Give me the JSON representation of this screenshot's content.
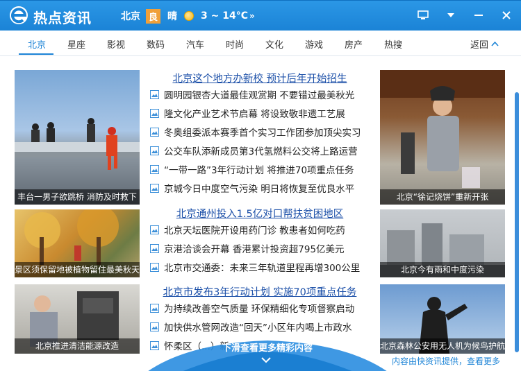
{
  "app": {
    "title": "热点资讯"
  },
  "weather": {
    "city": "北京",
    "air_quality": "良",
    "condition": "晴",
    "temperature": "3 ~ 14°C",
    "more": "»"
  },
  "nav": {
    "tabs": [
      "北京",
      "星座",
      "影视",
      "数码",
      "汽车",
      "时尚",
      "文化",
      "游戏",
      "房产",
      "热搜"
    ],
    "active_index": 0,
    "back_label": "返回"
  },
  "photos": [
    {
      "caption": "丰台一男子欲跳桥  消防及时救下"
    },
    {
      "caption": "北京“徐记烧饼”重新开张"
    },
    {
      "caption": "景区须保留地被植物留住最美秋天"
    },
    {
      "caption": "北京今有雨和中度污染"
    },
    {
      "caption": "北京推进清洁能源改造"
    },
    {
      "caption": "北京森林公安用无人机为候鸟护航"
    }
  ],
  "sections": [
    {
      "headline": "北京这个地方办新校  预计后年开始招生",
      "items": [
        "圆明园银杏大道最佳观赏期  不要错过最美秋光",
        "隆文化产业艺术节启幕  将设致敬非遗工艺展",
        "冬奥组委派本赛季首个实习工作团参加顶尖实习",
        "公交车队添新成员第3代氢燃料公交将上路运营",
        "“一带一路”3年行动计划  将推进70项重点任务",
        "京城今日中度空气污染  明日将恢复至优良水平"
      ]
    },
    {
      "headline": "北京通州投入1.5亿对口帮扶贫困地区",
      "items": [
        "北京天坛医院开设用药门诊  教患者如何吃药",
        "京港洽谈会开幕  香港累计投资超795亿美元",
        "北京市交通委：未来三年轨道里程再增300公里"
      ]
    },
    {
      "headline": "北京市发布3年行动计划  实施70项重点任务",
      "items": [
        "为持续改善空气质量  环保精细化专项督察启动",
        "加快供水管网改造“回天”小区年内喝上市政水",
        "怀柔区（...）新"
      ]
    }
  ],
  "footer": {
    "more_prompt": "下滑查看更多精彩内容",
    "source_link": "内容由快资讯提供，查看更多"
  },
  "colors": {
    "titlebar": "#1b83d6",
    "accent": "#1b83d6",
    "headline": "#1b4fa8",
    "aq_badge": "#f0a03a"
  }
}
